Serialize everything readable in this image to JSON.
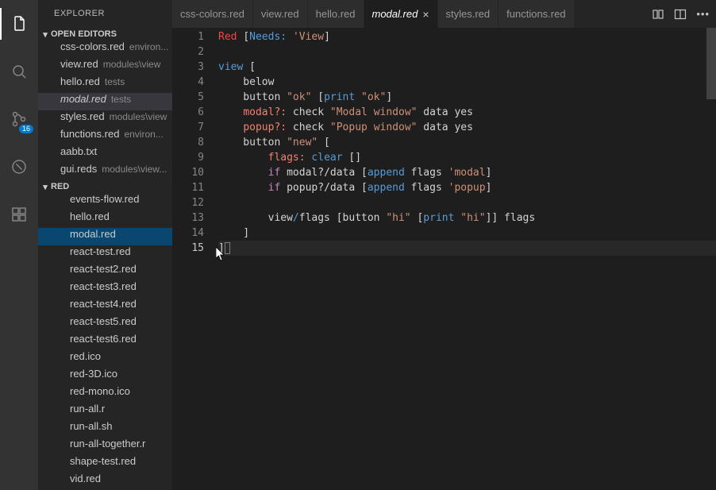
{
  "activityBar": {
    "items": [
      {
        "name": "files-icon",
        "active": true
      },
      {
        "name": "search-icon"
      },
      {
        "name": "scm-icon",
        "badge": "16"
      },
      {
        "name": "debug-icon"
      },
      {
        "name": "extensions-icon"
      }
    ]
  },
  "sidebar": {
    "title": "EXPLORER",
    "openEditors": {
      "header": "OPEN EDITORS",
      "items": [
        {
          "name": "css-colors.red",
          "desc": "environ..."
        },
        {
          "name": "view.red",
          "desc": "modules\\view"
        },
        {
          "name": "hello.red",
          "desc": "tests"
        },
        {
          "name": "modal.red",
          "desc": "tests",
          "selected": true,
          "modified": true
        },
        {
          "name": "styles.red",
          "desc": "modules\\view"
        },
        {
          "name": "functions.red",
          "desc": "environ..."
        },
        {
          "name": "aabb.txt",
          "desc": ""
        },
        {
          "name": "gui.reds",
          "desc": "modules\\view..."
        }
      ]
    },
    "folder": {
      "header": "RED",
      "items": [
        {
          "name": "events-flow.red"
        },
        {
          "name": "hello.red"
        },
        {
          "name": "modal.red",
          "selected": true
        },
        {
          "name": "react-test.red"
        },
        {
          "name": "react-test2.red"
        },
        {
          "name": "react-test3.red"
        },
        {
          "name": "react-test4.red"
        },
        {
          "name": "react-test5.red"
        },
        {
          "name": "react-test6.red"
        },
        {
          "name": "red.ico"
        },
        {
          "name": "red-3D.ico"
        },
        {
          "name": "red-mono.ico"
        },
        {
          "name": "run-all.r"
        },
        {
          "name": "run-all.sh"
        },
        {
          "name": "run-all-together.r"
        },
        {
          "name": "shape-test.red"
        },
        {
          "name": "vid.red"
        }
      ]
    }
  },
  "tabs": [
    {
      "label": "css-colors.red"
    },
    {
      "label": "view.red"
    },
    {
      "label": "hello.red"
    },
    {
      "label": "modal.red",
      "active": true,
      "modified": true
    },
    {
      "label": "styles.red"
    },
    {
      "label": "functions.red"
    }
  ],
  "code": {
    "lines": [
      [
        {
          "t": "Red ",
          "c": "tk-red"
        },
        {
          "t": "[",
          "c": ""
        },
        {
          "t": "Needs:",
          "c": "tk-blue"
        },
        {
          "t": " ",
          "c": ""
        },
        {
          "t": "'View",
          "c": "tk-ora"
        },
        {
          "t": "]",
          "c": ""
        }
      ],
      [],
      [
        {
          "t": "view ",
          "c": "tk-blue"
        },
        {
          "t": "[",
          "c": ""
        }
      ],
      [
        {
          "t": "    below",
          "c": ""
        }
      ],
      [
        {
          "t": "    button ",
          "c": ""
        },
        {
          "t": "\"ok\"",
          "c": "tk-ora"
        },
        {
          "t": " [",
          "c": ""
        },
        {
          "t": "print ",
          "c": "tk-blue"
        },
        {
          "t": "\"ok\"",
          "c": "tk-ora"
        },
        {
          "t": "]",
          "c": ""
        }
      ],
      [
        {
          "t": "    ",
          "c": ""
        },
        {
          "t": "modal?:",
          "c": "tk-set"
        },
        {
          "t": " check ",
          "c": ""
        },
        {
          "t": "\"Modal window\"",
          "c": "tk-ora"
        },
        {
          "t": " data yes",
          "c": ""
        }
      ],
      [
        {
          "t": "    ",
          "c": ""
        },
        {
          "t": "popup?:",
          "c": "tk-set"
        },
        {
          "t": " check ",
          "c": ""
        },
        {
          "t": "\"Popup window\"",
          "c": "tk-ora"
        },
        {
          "t": " data yes",
          "c": ""
        }
      ],
      [
        {
          "t": "    button ",
          "c": ""
        },
        {
          "t": "\"new\"",
          "c": "tk-ora"
        },
        {
          "t": " [",
          "c": ""
        }
      ],
      [
        {
          "t": "        ",
          "c": ""
        },
        {
          "t": "flags:",
          "c": "tk-set"
        },
        {
          "t": " ",
          "c": ""
        },
        {
          "t": "clear",
          "c": "tk-blue"
        },
        {
          "t": " []",
          "c": ""
        }
      ],
      [
        {
          "t": "        ",
          "c": ""
        },
        {
          "t": "if",
          "c": "tk-key"
        },
        {
          "t": " modal?/data [",
          "c": ""
        },
        {
          "t": "append",
          "c": "tk-blue"
        },
        {
          "t": " flags ",
          "c": ""
        },
        {
          "t": "'modal",
          "c": "tk-ora"
        },
        {
          "t": "]",
          "c": ""
        }
      ],
      [
        {
          "t": "        ",
          "c": ""
        },
        {
          "t": "if",
          "c": "tk-key"
        },
        {
          "t": " popup?/data [",
          "c": ""
        },
        {
          "t": "append",
          "c": "tk-blue"
        },
        {
          "t": " flags ",
          "c": ""
        },
        {
          "t": "'popup",
          "c": "tk-ora"
        },
        {
          "t": "]",
          "c": ""
        }
      ],
      [],
      [
        {
          "t": "        view",
          "c": ""
        },
        {
          "t": "/",
          "c": "tk-blue"
        },
        {
          "t": "flags [button ",
          "c": ""
        },
        {
          "t": "\"hi\"",
          "c": "tk-ora"
        },
        {
          "t": " [",
          "c": ""
        },
        {
          "t": "print ",
          "c": "tk-blue"
        },
        {
          "t": "\"hi\"",
          "c": "tk-ora"
        },
        {
          "t": "]] flags",
          "c": ""
        }
      ],
      [
        {
          "t": "    ]",
          "c": ""
        }
      ],
      [
        {
          "t": "]",
          "c": "",
          "cursorAfter": true
        }
      ]
    ]
  }
}
